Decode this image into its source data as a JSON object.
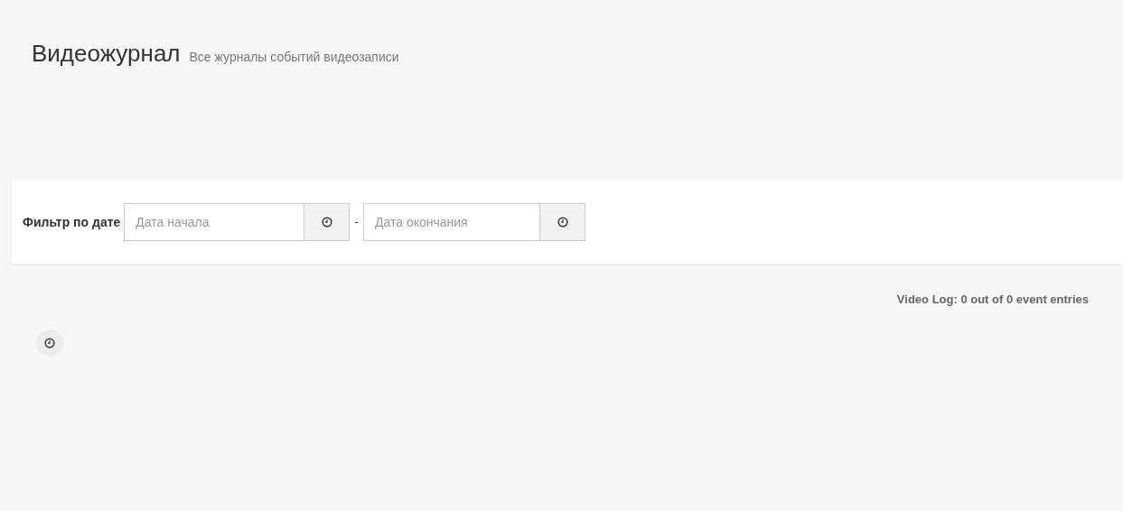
{
  "header": {
    "title": "Видеожурнал",
    "subtitle": "Все журналы событий видеозаписи"
  },
  "filter": {
    "label": "Фильтр по дате",
    "start": {
      "placeholder": "Дата начала"
    },
    "separator": "-",
    "end": {
      "placeholder": "Дата окончания"
    }
  },
  "summary": "Video Log: 0 out of 0 event entries"
}
